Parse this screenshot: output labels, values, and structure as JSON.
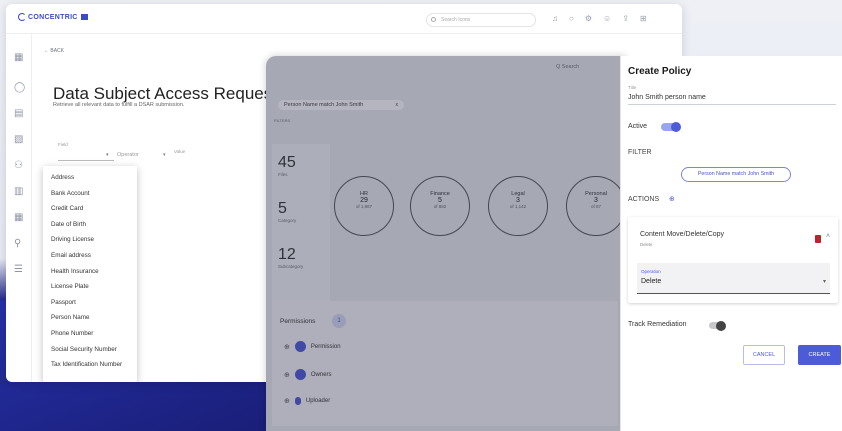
{
  "app": {
    "logo_text": "CONCENTRIC",
    "search_placeholder": "Search Icons",
    "back_label": "BACK"
  },
  "dsar": {
    "title": "Data Subject Access Request",
    "subtitle": "Retrieve all relevant data to fulfill a DSAR submission.",
    "field_label": "Field",
    "operator_label": "Operator",
    "value_label": "Value"
  },
  "dropdown": {
    "options": [
      "Address",
      "Bank Account",
      "Credit Card",
      "Date of Birth",
      "Driving License",
      "Email address",
      "Health Insurance",
      "License Plate",
      "Passport",
      "Person Name",
      "Phone Number",
      "Social Security Number",
      "Tax Identification Number"
    ]
  },
  "mid": {
    "search_text": "Q Search",
    "chip_text": "Person Name match John Smith",
    "chip_close": "x",
    "section_label": "FILTERS",
    "stats": [
      {
        "num": "45",
        "label": "Files"
      },
      {
        "num": "5",
        "label": "Category"
      },
      {
        "num": "12",
        "label": "Subcategory"
      }
    ],
    "circles": [
      {
        "name": "HR",
        "value": "29",
        "of": "of 1,987"
      },
      {
        "name": "Finance",
        "value": "5",
        "of": "of 882"
      },
      {
        "name": "Legal",
        "value": "3",
        "of": "of 1,142"
      },
      {
        "name": "Personal",
        "value": "3",
        "of": "of 87"
      }
    ],
    "permissions_title": "Permissions",
    "permissions_badge": "1",
    "perm_rows": [
      "Permission",
      "Owners",
      "Uploader"
    ]
  },
  "policy": {
    "title": "Create Policy",
    "title_label": "Title",
    "title_value": "John Smith person name",
    "active_label": "Active",
    "filter_label": "FILTER",
    "filter_chip": "Person Name match John Smith",
    "actions_label": "ACTIONS",
    "action_name": "Content Move/Delete/Copy",
    "action_sub": "Delete",
    "operation_label": "Operation",
    "operation_value": "Delete",
    "track_label": "Track Remediation",
    "cancel": "CANCEL",
    "create": "CREATE"
  }
}
